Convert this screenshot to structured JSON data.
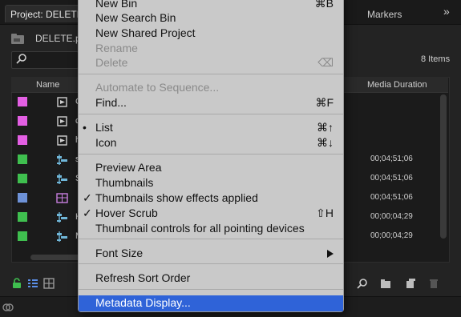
{
  "panel": {
    "tab_title": "Project: DELETE",
    "tab_markers": "Markers",
    "overflow": "»",
    "project_file": "DELETE.prp",
    "items_count": "8 Items",
    "columns": {
      "name": "Name",
      "media_duration": "Media Duration"
    },
    "rows": [
      {
        "color": "#e35fe3",
        "label": "C",
        "duration": ""
      },
      {
        "color": "#e35fe3",
        "label": "c",
        "duration": ""
      },
      {
        "color": "#e35fe3",
        "label": "h",
        "duration": ""
      },
      {
        "color": "#3fbf4f",
        "label": "s",
        "duration": "00;04;51;06"
      },
      {
        "color": "#3fbf4f",
        "label": "S",
        "duration": "00;04;51;06"
      },
      {
        "color": "#6e92d8",
        "label": "",
        "duration": "00;04;51;06"
      },
      {
        "color": "#3fbf4f",
        "label": "H",
        "duration": "00;00;04;29"
      },
      {
        "color": "#3fbf4f",
        "label": "M",
        "duration": "00;00;04;29"
      }
    ]
  },
  "menu": {
    "items": [
      {
        "label": "New Bin",
        "shortcut": "⌘B"
      },
      {
        "label": "New Search Bin",
        "shortcut": ""
      },
      {
        "label": "New Shared Project",
        "shortcut": ""
      },
      {
        "label": "Rename",
        "shortcut": ""
      },
      {
        "label": "Delete",
        "shortcut": "⌫"
      },
      {
        "label": "Automate to Sequence...",
        "shortcut": ""
      },
      {
        "label": "Find...",
        "shortcut": "⌘F"
      },
      {
        "label": "List",
        "shortcut": "⌘↑",
        "mark": "•"
      },
      {
        "label": "Icon",
        "shortcut": "⌘↓"
      },
      {
        "label": "Preview Area",
        "shortcut": ""
      },
      {
        "label": "Thumbnails",
        "shortcut": ""
      },
      {
        "label": "Thumbnails show effects applied",
        "shortcut": "",
        "mark": "✓"
      },
      {
        "label": "Hover Scrub",
        "shortcut": "⇧H",
        "mark": "✓"
      },
      {
        "label": "Thumbnail controls for all pointing devices",
        "shortcut": ""
      },
      {
        "label": "Font Size",
        "shortcut": ""
      },
      {
        "label": "Refresh Sort Order",
        "shortcut": ""
      },
      {
        "label": "Metadata Display...",
        "shortcut": ""
      }
    ]
  }
}
